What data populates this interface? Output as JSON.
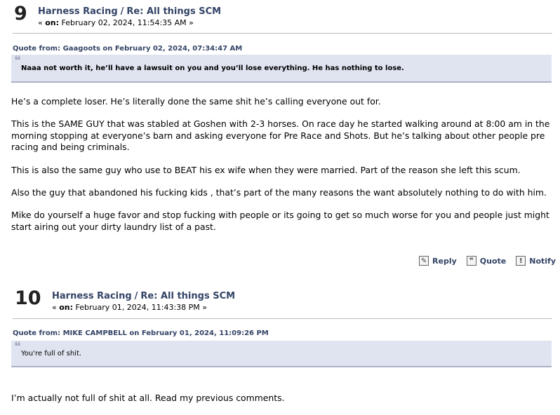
{
  "posts": [
    {
      "number": "9",
      "board": "Harness Racing",
      "separator": "/",
      "subject": "Re: All things SCM",
      "date_prefix": "« ",
      "on_label": "on:",
      "date": " February 02, 2024, 11:54:35 AM »",
      "quote_header": "Quote from: Gaagoots on February 02, 2024, 07:34:47 AM",
      "quote_mark": "❝",
      "quote_text": "Naaa not worth it, he’ll have a lawsuit on you and you’ll lose everything. He has nothing to lose.",
      "paragraphs": [
        "He’s a complete loser. He’s literally done the same shit he’s calling everyone out for.",
        "This is the SAME GUY that was stabled at Goshen with 2-3 horses. On race day he started walking around at 8:00 am in the morning stopping at everyone’s barn and asking everyone for Pre Race and Shots. But he’s talking about other people pre racing and being criminals.",
        "This is also the same guy who use to BEAT his ex wife when they were married. Part of the reason she left this scum.",
        "Also the guy that abandoned his fucking kids , that’s part of the many reasons the want absolutely nothing to do with him.",
        "Mike do yourself a huge favor and stop fucking with people or its going to get so much worse for you and people just might start airing out your dirty laundry list of a past."
      ],
      "actions": {
        "reply": "Reply",
        "quote": "Quote",
        "notify": "Notify"
      }
    },
    {
      "number": "10",
      "board": "Harness Racing",
      "separator": "/",
      "subject": "Re: All things SCM",
      "date_prefix": "« ",
      "on_label": "on:",
      "date": " February 01, 2024, 11:43:38 PM »",
      "quote_header": "Quote from: MIKE CAMPBELL on February 01, 2024, 11:09:26 PM",
      "quote_mark": "❝",
      "quote_text": "You're full of shit.",
      "paragraphs": [
        "I’m actually not full of shit at all. Read my previous comments."
      ]
    }
  ],
  "icons": {
    "reply": "reply-icon",
    "quote": "quote-icon",
    "notify": "notify-icon"
  }
}
